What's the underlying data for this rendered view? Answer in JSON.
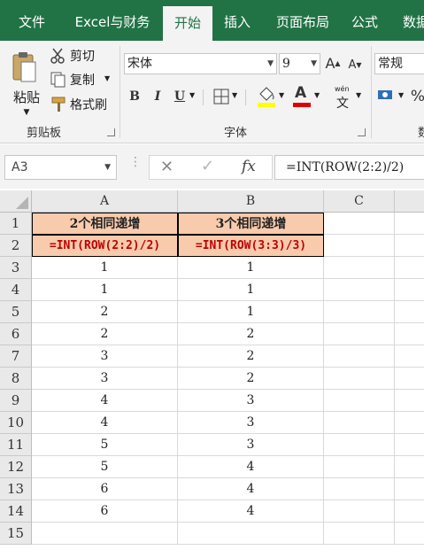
{
  "tabs": [
    {
      "label": "文件"
    },
    {
      "label": "Excel与财务"
    },
    {
      "label": "开始"
    },
    {
      "label": "插入"
    },
    {
      "label": "页面布局"
    },
    {
      "label": "公式"
    },
    {
      "label": "数据"
    }
  ],
  "active_tab": "开始",
  "clipboard": {
    "paste_label": "粘贴",
    "cut_label": "剪切",
    "copy_label": "复制",
    "format_painter_label": "格式刷",
    "group_label": "剪贴板"
  },
  "font": {
    "font_name": "宋体",
    "font_size": "9",
    "grow_label": "A",
    "shrink_label": "A",
    "bold_label": "B",
    "italic_label": "I",
    "underline_label": "U",
    "phonetic_label": "wén",
    "phonetic_char": "文",
    "group_label": "字体",
    "font_color": "#e00000",
    "highlight_color": "#ffff00"
  },
  "number": {
    "format": "常规",
    "percent_label": "%",
    "group_label_partial": "数"
  },
  "formula_bar": {
    "name_box": "A3",
    "fx_label": "fx",
    "formula": "=INT(ROW(2:2)/2)"
  },
  "sheet": {
    "columns": [
      "A",
      "B",
      "C"
    ],
    "rows": [
      "1",
      "2",
      "3",
      "4",
      "5",
      "6",
      "7",
      "8",
      "9",
      "10",
      "11",
      "12",
      "13",
      "14",
      "15"
    ],
    "header_row": {
      "a": "2个相同递增",
      "b": "3个相同递增"
    },
    "formula_row": {
      "a": "=INT(ROW(2:2)/2)",
      "b": "=INT(ROW(3:3)/3)"
    },
    "data": [
      {
        "a": "1",
        "b": "1"
      },
      {
        "a": "1",
        "b": "1"
      },
      {
        "a": "2",
        "b": "1"
      },
      {
        "a": "2",
        "b": "2"
      },
      {
        "a": "3",
        "b": "2"
      },
      {
        "a": "3",
        "b": "2"
      },
      {
        "a": "4",
        "b": "3"
      },
      {
        "a": "4",
        "b": "3"
      },
      {
        "a": "5",
        "b": "3"
      },
      {
        "a": "5",
        "b": "4"
      },
      {
        "a": "6",
        "b": "4"
      },
      {
        "a": "6",
        "b": "4"
      }
    ],
    "header_fill": "#f8cbad",
    "formula_color": "#c00000"
  }
}
